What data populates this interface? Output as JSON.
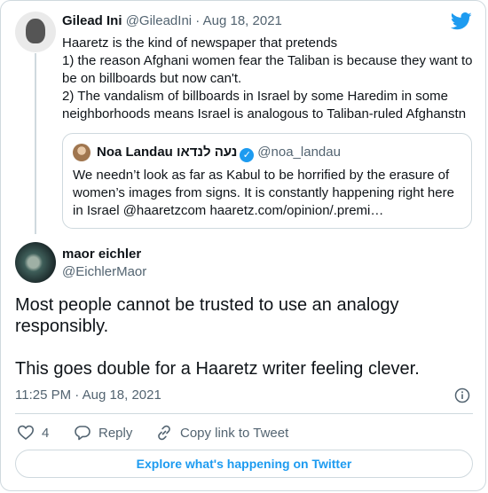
{
  "tweet1": {
    "name": "Gilead Ini",
    "handle": "@GileadIni",
    "date": "· Aug 18, 2021",
    "text": "Haaretz is the kind of newspaper that pretends\n1) the reason Afghani women fear the Taliban is because they want to be on billboards but now can't.\n2) The vandalism of billboards in Israel by some Haredim in some neighborhoods means Israel is analogous to Taliban-ruled Afghanstn"
  },
  "quote": {
    "name": "Noa Landau נעה לנדאו",
    "handle": "@noa_landau",
    "text": "We needn’t look as far as Kabul to be horrified by the erasure of women’s images from signs. It is constantly happening right here in Israel @haaretzcom  haaretz.com/opinion/.premi…"
  },
  "tweet2": {
    "name": "maor eichler",
    "handle": "@EichlerMaor",
    "text": "Most people cannot be trusted to use an analogy responsibly.\n\nThis goes double for a Haaretz writer feeling clever.",
    "timestamp": "11:25 PM · Aug 18, 2021"
  },
  "actions": {
    "like_count": "4",
    "reply_label": "Reply",
    "copy_label": "Copy link to Tweet"
  },
  "explore_label": "Explore what's happening on Twitter",
  "colors": {
    "accent": "#1d9bf0",
    "muted": "#536471",
    "border": "#cfd9de"
  },
  "icons": [
    "twitter-logo-icon",
    "verified-badge-icon",
    "info-icon",
    "heart-icon",
    "reply-icon",
    "link-icon"
  ]
}
